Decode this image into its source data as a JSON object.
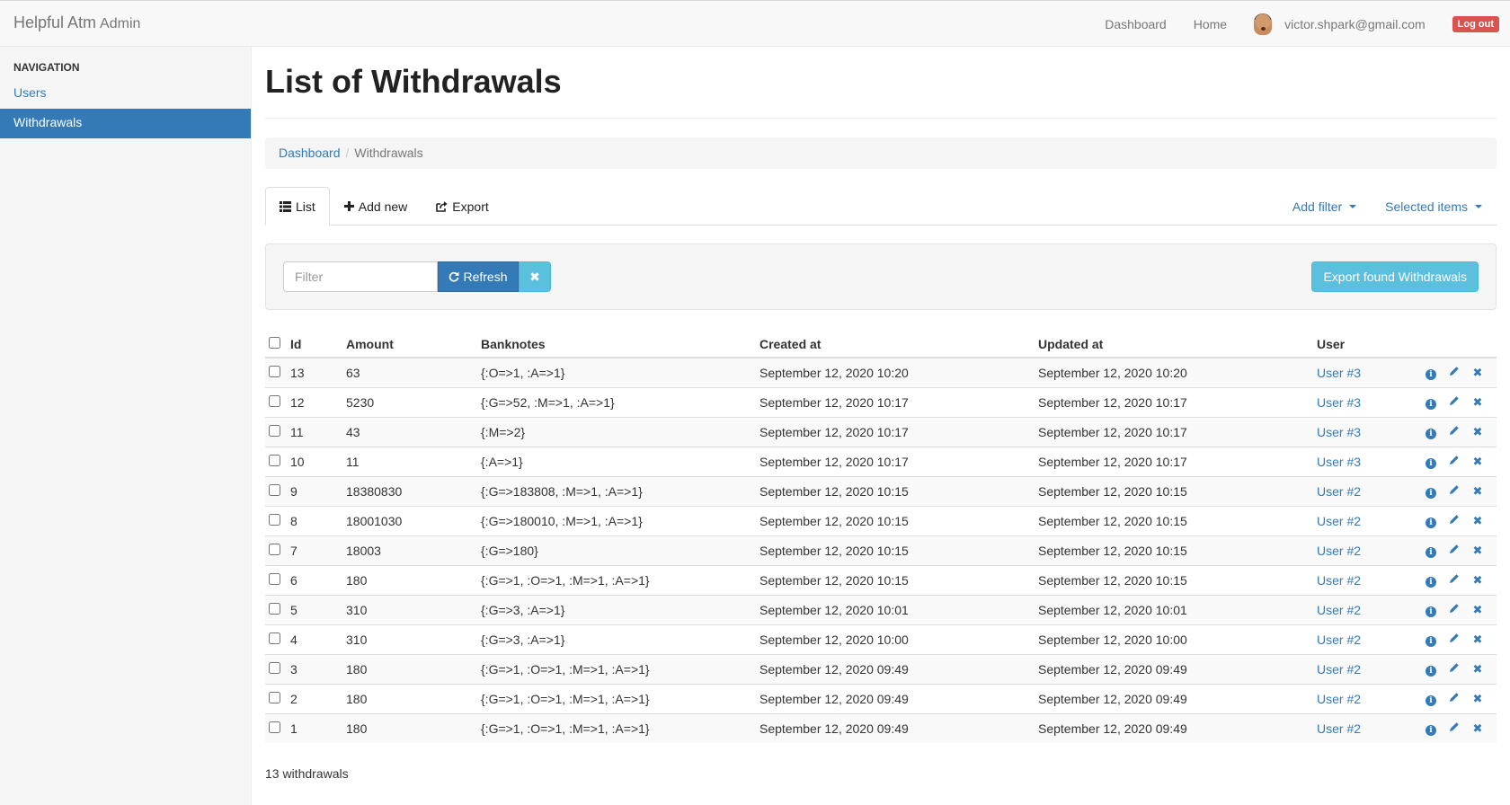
{
  "navbar": {
    "brand": "Helpful Atm",
    "brand_sub": "Admin",
    "links": [
      "Dashboard",
      "Home"
    ],
    "user_email": "victor.shpark@gmail.com",
    "logout": "Log out"
  },
  "sidebar": {
    "header": "Navigation",
    "items": [
      {
        "label": "Users",
        "active": false
      },
      {
        "label": "Withdrawals",
        "active": true
      }
    ]
  },
  "main": {
    "title": "List of Withdrawals",
    "breadcrumb": {
      "link": "Dashboard",
      "current": "Withdrawals"
    },
    "tabs": {
      "list": "List",
      "add_new": "Add new",
      "export": "Export",
      "add_filter": "Add filter",
      "selected_items": "Selected items"
    },
    "filter": {
      "placeholder": "Filter",
      "refresh": "Refresh",
      "export_found": "Export found Withdrawals"
    },
    "table": {
      "headers": {
        "id": "Id",
        "amount": "Amount",
        "banknotes": "Banknotes",
        "created_at": "Created at",
        "updated_at": "Updated at",
        "user": "User"
      },
      "rows": [
        {
          "id": "13",
          "amount": "63",
          "banknotes": "{:O=>1, :A=>1}",
          "created": "September 12, 2020 10:20",
          "updated": "September 12, 2020 10:20",
          "user": "User #3"
        },
        {
          "id": "12",
          "amount": "5230",
          "banknotes": "{:G=>52, :M=>1, :A=>1}",
          "created": "September 12, 2020 10:17",
          "updated": "September 12, 2020 10:17",
          "user": "User #3"
        },
        {
          "id": "11",
          "amount": "43",
          "banknotes": "{:M=>2}",
          "created": "September 12, 2020 10:17",
          "updated": "September 12, 2020 10:17",
          "user": "User #3"
        },
        {
          "id": "10",
          "amount": "11",
          "banknotes": "{:A=>1}",
          "created": "September 12, 2020 10:17",
          "updated": "September 12, 2020 10:17",
          "user": "User #3"
        },
        {
          "id": "9",
          "amount": "18380830",
          "banknotes": "{:G=>183808, :M=>1, :A=>1}",
          "created": "September 12, 2020 10:15",
          "updated": "September 12, 2020 10:15",
          "user": "User #2"
        },
        {
          "id": "8",
          "amount": "18001030",
          "banknotes": "{:G=>180010, :M=>1, :A=>1}",
          "created": "September 12, 2020 10:15",
          "updated": "September 12, 2020 10:15",
          "user": "User #2"
        },
        {
          "id": "7",
          "amount": "18003",
          "banknotes": "{:G=>180}",
          "created": "September 12, 2020 10:15",
          "updated": "September 12, 2020 10:15",
          "user": "User #2"
        },
        {
          "id": "6",
          "amount": "180",
          "banknotes": "{:G=>1, :O=>1, :M=>1, :A=>1}",
          "created": "September 12, 2020 10:15",
          "updated": "September 12, 2020 10:15",
          "user": "User #2"
        },
        {
          "id": "5",
          "amount": "310",
          "banknotes": "{:G=>3, :A=>1}",
          "created": "September 12, 2020 10:01",
          "updated": "September 12, 2020 10:01",
          "user": "User #2"
        },
        {
          "id": "4",
          "amount": "310",
          "banknotes": "{:G=>3, :A=>1}",
          "created": "September 12, 2020 10:00",
          "updated": "September 12, 2020 10:00",
          "user": "User #2"
        },
        {
          "id": "3",
          "amount": "180",
          "banknotes": "{:G=>1, :O=>1, :M=>1, :A=>1}",
          "created": "September 12, 2020 09:49",
          "updated": "September 12, 2020 09:49",
          "user": "User #2"
        },
        {
          "id": "2",
          "amount": "180",
          "banknotes": "{:G=>1, :O=>1, :M=>1, :A=>1}",
          "created": "September 12, 2020 09:49",
          "updated": "September 12, 2020 09:49",
          "user": "User #2"
        },
        {
          "id": "1",
          "amount": "180",
          "banknotes": "{:G=>1, :O=>1, :M=>1, :A=>1}",
          "created": "September 12, 2020 09:49",
          "updated": "September 12, 2020 09:49",
          "user": "User #2"
        }
      ]
    },
    "count_text": "13 withdrawals"
  },
  "icons": {
    "list": "list-icon",
    "add": "plus-icon",
    "export": "share-icon",
    "refresh": "refresh-icon",
    "clear": "times-icon",
    "info": "info-icon",
    "edit": "pencil-icon",
    "delete": "times-icon"
  },
  "colors": {
    "primary": "#337ab7",
    "info": "#5bc0de",
    "danger": "#d9534f"
  }
}
